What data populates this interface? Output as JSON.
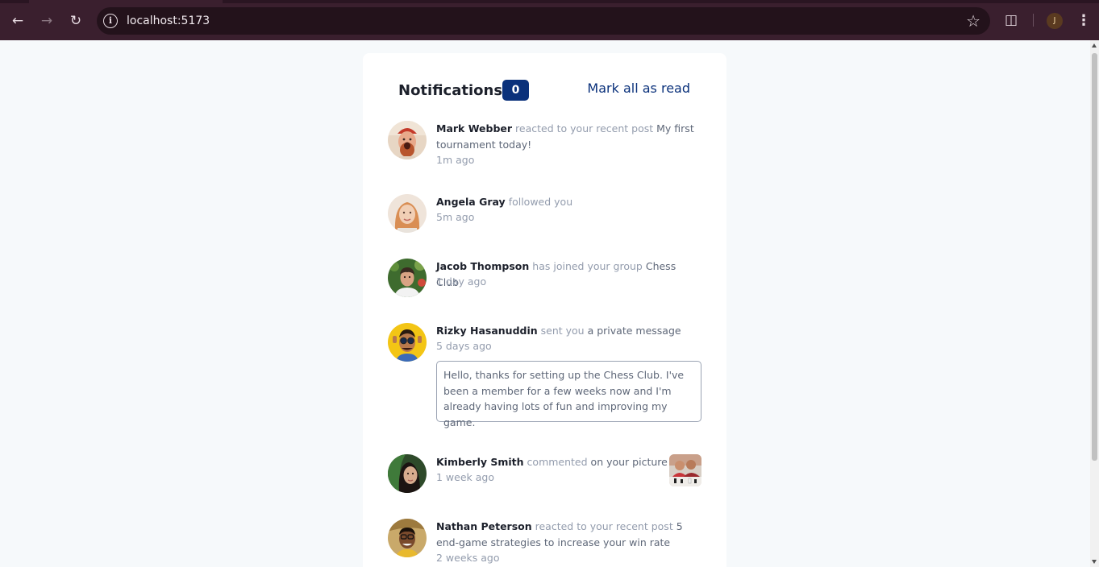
{
  "browser": {
    "url": "localhost:5173",
    "profile_initial": "J"
  },
  "header": {
    "title": "Notifications",
    "unread_count": "0",
    "mark_all_label": "Mark all as read"
  },
  "notifications": [
    {
      "name": "Mark Webber",
      "action": "reacted to your recent post",
      "target": "My first tournament today!",
      "time": "1m ago"
    },
    {
      "name": "Angela Gray",
      "action": "followed you",
      "target": "",
      "time": "5m ago"
    },
    {
      "name": "Jacob Thompson",
      "action": "has joined your group",
      "target": "Chess Club",
      "time": "1 day ago"
    },
    {
      "name": "Rizky Hasanuddin",
      "action": "sent you",
      "target": "a private message",
      "time": "5 days ago",
      "message": "Hello, thanks for setting up the Chess Club. I've been a member for a few weeks now and I'm already having lots of fun and improving my game."
    },
    {
      "name": "Kimberly Smith",
      "action": "commented",
      "target": "on your picture",
      "time": "1 week ago"
    },
    {
      "name": "Nathan Peterson",
      "action": "reacted to your recent post",
      "target": "5 end-game strategies to increase your win rate",
      "time": "2 weeks ago"
    }
  ],
  "colors": {
    "accent": "#0a317b",
    "page_bg": "#f6f9fb",
    "card_bg": "#ffffff"
  }
}
